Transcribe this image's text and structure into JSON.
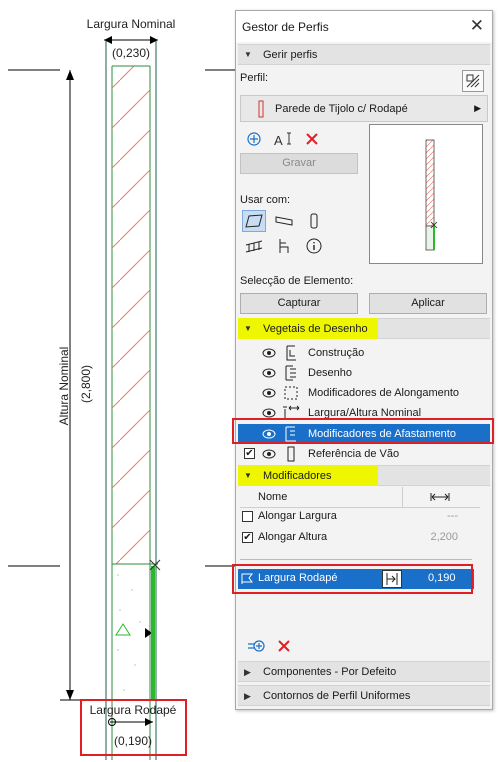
{
  "drawing": {
    "width_label": "Largura Nominal",
    "width_value": "(0,230)",
    "height_label": "Altura Nominal",
    "height_value": "(2,800)",
    "skirting_label": "Largura Rodapé",
    "skirting_value": "(0,190)"
  },
  "panel": {
    "title": "Gestor de Perfis",
    "close": "✕",
    "manage_section": "Gerir perfis",
    "profile_label": "Perfil:",
    "profile_value": "Parede de Tijolo c/ Rodapé",
    "save_button": "Gravar",
    "use_with_label": "Usar com:",
    "element_selection_label": "Selecção de Elemento:",
    "capture_button": "Capturar",
    "apply_button": "Aplicar",
    "drawing_vectors_section": "Vegetais de Desenho",
    "layers": [
      {
        "label": "Construção"
      },
      {
        "label": "Desenho"
      },
      {
        "label": "Modificadores de Alongamento"
      },
      {
        "label": "Largura/Altura Nominal"
      },
      {
        "label": "Modificadores de Afastamento"
      },
      {
        "label": "Referência de Vão"
      }
    ],
    "modifiers_section": "Modificadores",
    "modifiers_header_name": "Nome",
    "modifiers": [
      {
        "label": "Alongar Largura",
        "value": "---",
        "checked": false
      },
      {
        "label": "Alongar Altura",
        "value": "2,200",
        "checked": true
      }
    ],
    "offset_modifier": {
      "label": "Largura Rodapé",
      "value": "0,190"
    },
    "components_section": "Componentes - Por Defeito",
    "contours_section": "Contornos de Perfil Uniformes"
  },
  "colors": {
    "highlight": "#eef700",
    "selection": "#1a6fc9",
    "annotation_red": "#e01e25",
    "hatch": "#e88070",
    "green": "#2cb82c"
  }
}
